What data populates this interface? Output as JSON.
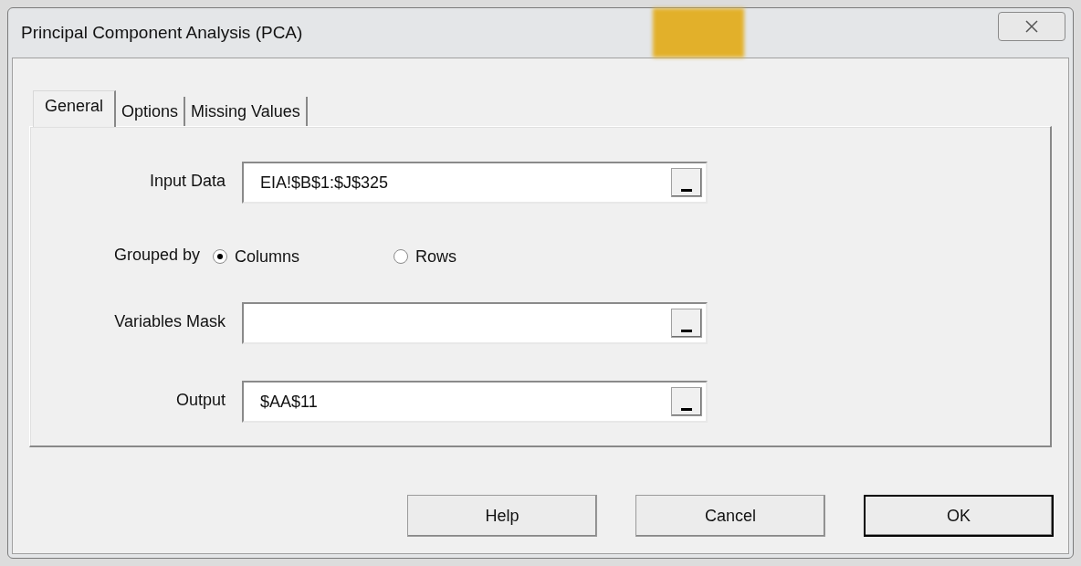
{
  "window": {
    "title": "Principal Component Analysis (PCA)"
  },
  "tabs": [
    {
      "label": "General",
      "selected": true
    },
    {
      "label": "Options",
      "selected": false
    },
    {
      "label": "Missing Values",
      "selected": false
    }
  ],
  "fields": [
    {
      "label": "Input Data",
      "value": "EIA!$B$1:$J$325"
    },
    {
      "label": "Variables Mask"
    },
    {
      "label": "Output",
      "value": "$AA$11"
    }
  ],
  "grouped_by": {
    "label": "Grouped by",
    "options": [
      {
        "label": "Columns",
        "selected": true
      },
      {
        "label": "Rows",
        "selected": false
      }
    ]
  },
  "buttons": [
    {
      "label": "Help",
      "default": false
    },
    {
      "label": "Cancel",
      "default": false
    },
    {
      "label": "OK",
      "default": true
    }
  ]
}
